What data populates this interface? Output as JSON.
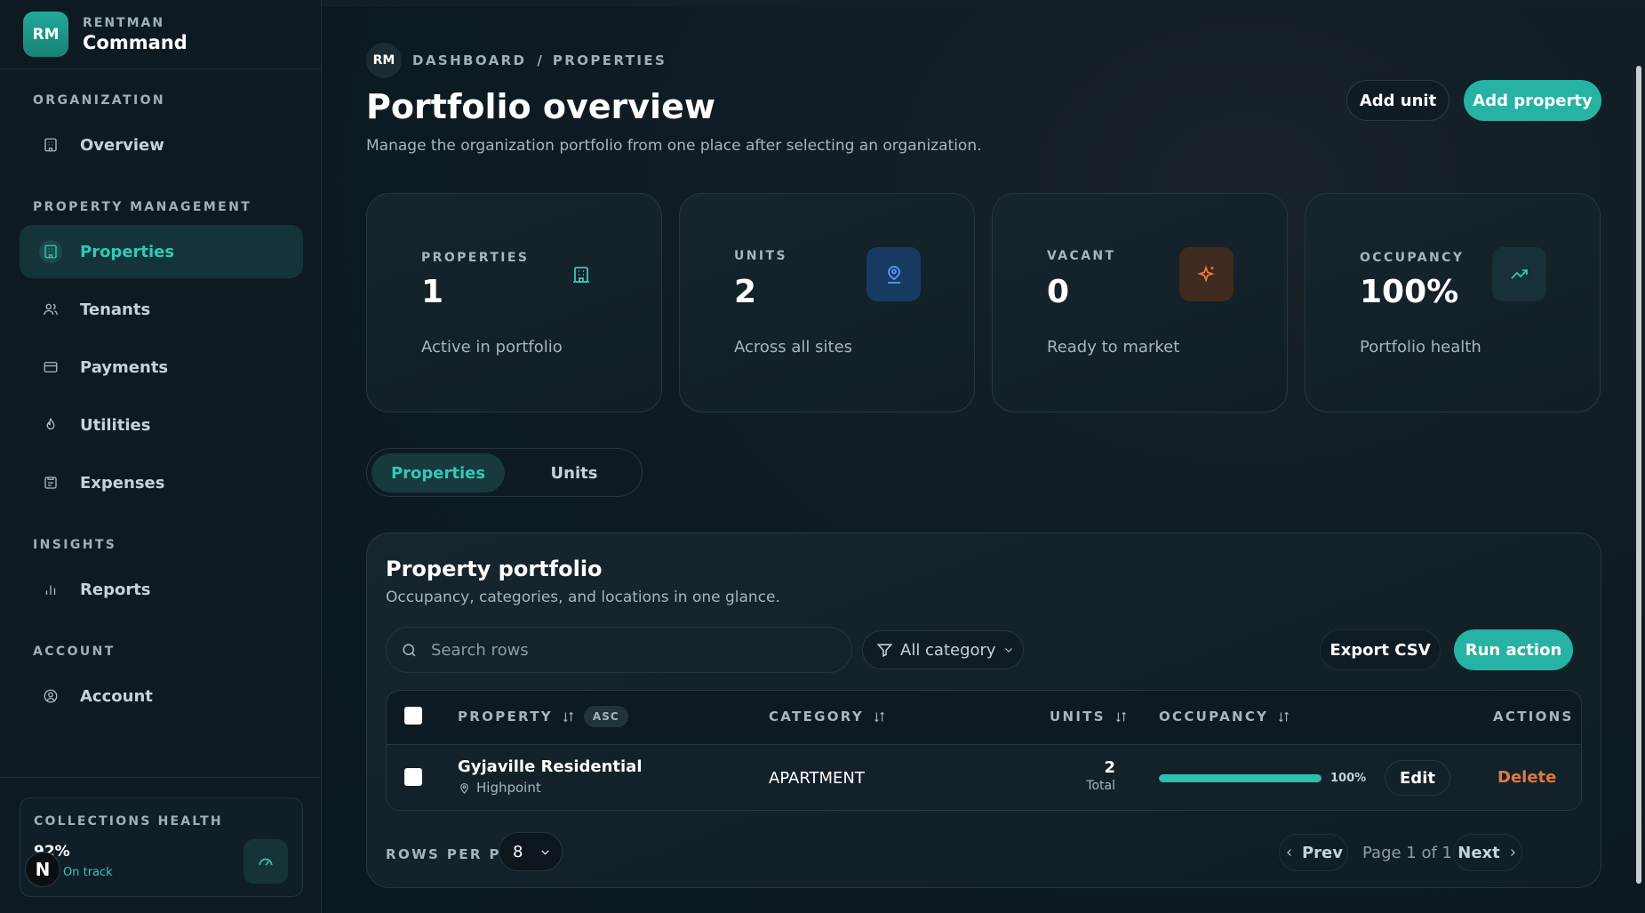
{
  "brand": {
    "logo": "RM",
    "top": "RENTMAN",
    "bottom": "Command"
  },
  "sidebar": {
    "sections": [
      {
        "title": "ORGANIZATION"
      },
      {
        "title": "PROPERTY MANAGEMENT"
      },
      {
        "title": "INSIGHTS"
      },
      {
        "title": "ACCOUNT"
      }
    ],
    "items": [
      {
        "label": "Overview",
        "icon": "building-icon"
      },
      {
        "label": "Properties",
        "icon": "building-icon",
        "active": true
      },
      {
        "label": "Tenants",
        "icon": "users-icon"
      },
      {
        "label": "Payments",
        "icon": "card-icon"
      },
      {
        "label": "Utilities",
        "icon": "flame-icon"
      },
      {
        "label": "Expenses",
        "icon": "receipt-icon"
      },
      {
        "label": "Reports",
        "icon": "bar-chart-icon"
      },
      {
        "label": "Account",
        "icon": "user-circle-icon"
      }
    ],
    "collections": {
      "title": "COLLECTIONS HEALTH",
      "value": "92%",
      "sub": "On track",
      "icon": "gauge-icon"
    },
    "n_badge": "N"
  },
  "breadcrumb": {
    "avatar": "RM",
    "items": [
      "DASHBOARD",
      "PROPERTIES"
    ],
    "separator": "/"
  },
  "header": {
    "title": "Portfolio overview",
    "subtitle": "Manage the organization portfolio from one place after selecting an organization.",
    "add_unit": "Add unit",
    "add_property": "Add property"
  },
  "stats": [
    {
      "label": "PROPERTIES",
      "value": "1",
      "note": "Active in portfolio",
      "icon": "building-icon",
      "color": "#33c8b6"
    },
    {
      "label": "UNITS",
      "value": "2",
      "note": "Across all sites",
      "icon": "map-pin-user-icon",
      "color": "#4e8ff0"
    },
    {
      "label": "VACANT",
      "value": "0",
      "note": "Ready to market",
      "icon": "sparkle-icon",
      "color": "#e07a3e"
    },
    {
      "label": "OCCUPANCY",
      "value": "100%",
      "note": "Portfolio health",
      "icon": "trend-up-icon",
      "color": "#33c8b6"
    }
  ],
  "tabs": [
    {
      "label": "Properties",
      "active": true
    },
    {
      "label": "Units",
      "active": false
    }
  ],
  "panel": {
    "title": "Property portfolio",
    "subtitle": "Occupancy, categories, and locations in one glance.",
    "search_placeholder": "Search rows",
    "filter_label": "All category",
    "export": "Export CSV",
    "run_action": "Run action"
  },
  "table": {
    "columns": {
      "property": "PROPERTY",
      "asc": "ASC",
      "category": "CATEGORY",
      "units": "UNITS",
      "occupancy": "OCCUPANCY",
      "actions": "ACTIONS"
    },
    "rows": [
      {
        "name": "Gyjaville Residential",
        "location": "Highpoint",
        "category": "APARTMENT",
        "units": "2",
        "units_sub": "Total",
        "occupancy": 1.0,
        "occupancy_label": "100%",
        "edit": "Edit",
        "delete": "Delete"
      }
    ]
  },
  "pagination": {
    "rows_per_page_label": "ROWS PER PAGE",
    "rows_per_page": "8",
    "prev": "Prev",
    "page_info": "Page 1 of 1",
    "next": "Next"
  }
}
